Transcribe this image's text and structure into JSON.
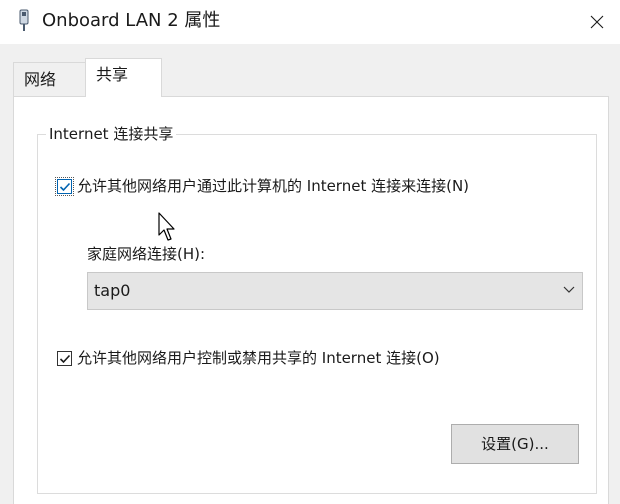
{
  "window": {
    "title": "Onboard LAN 2 属性",
    "icon": "network-adapter-icon",
    "close_glyph": "✕"
  },
  "tabs": [
    {
      "label": "网络",
      "active": false
    },
    {
      "label": "共享",
      "active": true
    }
  ],
  "group": {
    "title": "Internet 连接共享",
    "allow_share": {
      "label": "允许其他网络用户通过此计算机的 Internet 连接来连接(N)",
      "checked": true
    },
    "home_network": {
      "label": "家庭网络连接(H):",
      "selected_value": "tap0"
    },
    "allow_control": {
      "label": "允许其他网络用户控制或禁用共享的 Internet 连接(O)",
      "checked": true
    },
    "settings_button": "设置(G)..."
  },
  "colors": {
    "checkmark": "#0063b1",
    "panel_bg": "#ffffff",
    "chrome_bg": "#f0f0f0"
  }
}
